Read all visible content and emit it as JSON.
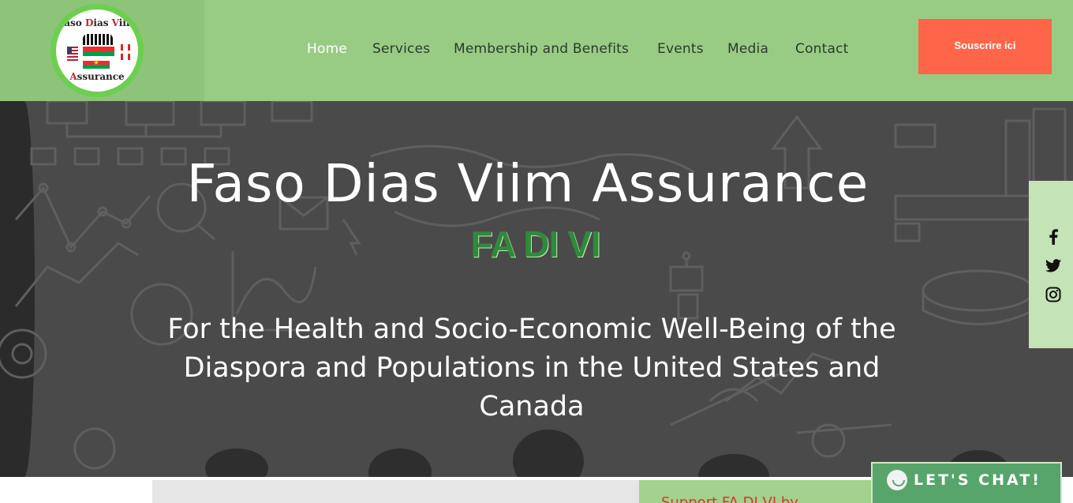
{
  "logo": {
    "top_text": "Faso Dias Viim",
    "bottom_text": "Assurance"
  },
  "nav": {
    "items": [
      {
        "label": "Home",
        "active": true
      },
      {
        "label": "Services"
      },
      {
        "label": "Membership and Benefits"
      },
      {
        "label": "Events"
      },
      {
        "label": "Media"
      },
      {
        "label": "Contact"
      }
    ]
  },
  "header": {
    "cta_label": "Souscrire ici"
  },
  "hero": {
    "title": "Faso Dias Viim Assurance",
    "acronym": "FA DI VI",
    "tagline": "For the Health and Socio-Economic Well-Being of the Diaspora and Populations in the United States and Canada"
  },
  "social": {
    "icons": [
      "facebook-icon",
      "twitter-icon",
      "instagram-icon"
    ]
  },
  "lower": {
    "support_text": "Support FA DI VI by"
  },
  "chat": {
    "label": "LET'S CHAT!"
  },
  "colors": {
    "header_bg": "#98cc85",
    "cta_bg": "#fe6549",
    "hero_bg": "#4a4a4a",
    "acronym": "#2f8a3b",
    "chat_bg": "#57a56b",
    "social_bar_bg": "#c4e3b6"
  }
}
